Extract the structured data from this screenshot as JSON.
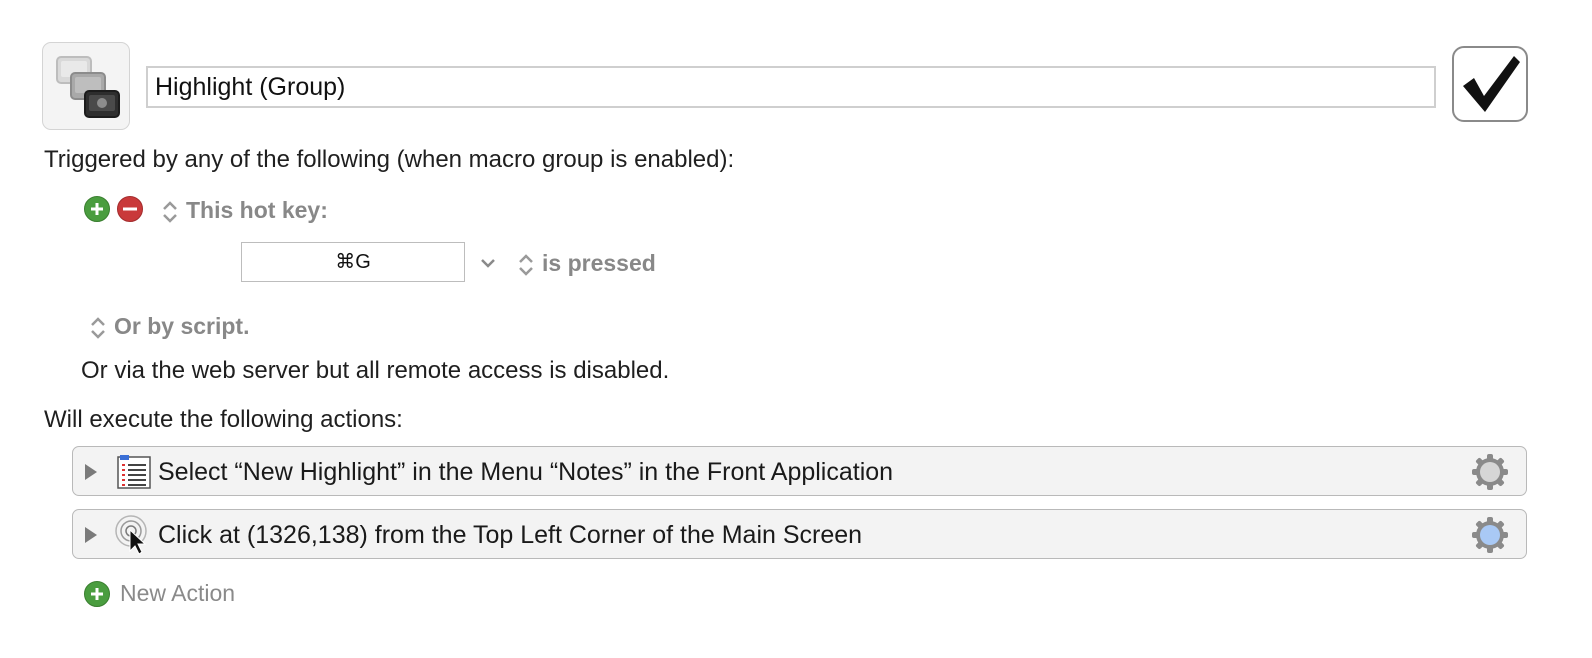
{
  "macro": {
    "name": "Highlight (Group)",
    "enabled": true
  },
  "triggers": {
    "heading": "Triggered by any of the following (when macro group is enabled):",
    "hotkey_label": "This hot key:",
    "hotkey_value": "⌘G",
    "hotkey_condition": "is pressed",
    "script_label": "Or by script.",
    "web_server_text": "Or via the web server but all remote access is disabled."
  },
  "actions": {
    "heading": "Will execute the following actions:",
    "items": [
      {
        "label": "Select “New Highlight” in the Menu “Notes” in the Front Application",
        "icon": "menu-list-icon"
      },
      {
        "label": "Click at (1326,138) from the Top Left Corner of the Main Screen",
        "icon": "mouse-click-icon"
      }
    ],
    "new_action_label": "New Action"
  },
  "colors": {
    "add_green": "#4a9d3f",
    "remove_red": "#c9393a",
    "gear_gray": "#8a8a8a",
    "gear_blue": "#a9c9f5"
  }
}
